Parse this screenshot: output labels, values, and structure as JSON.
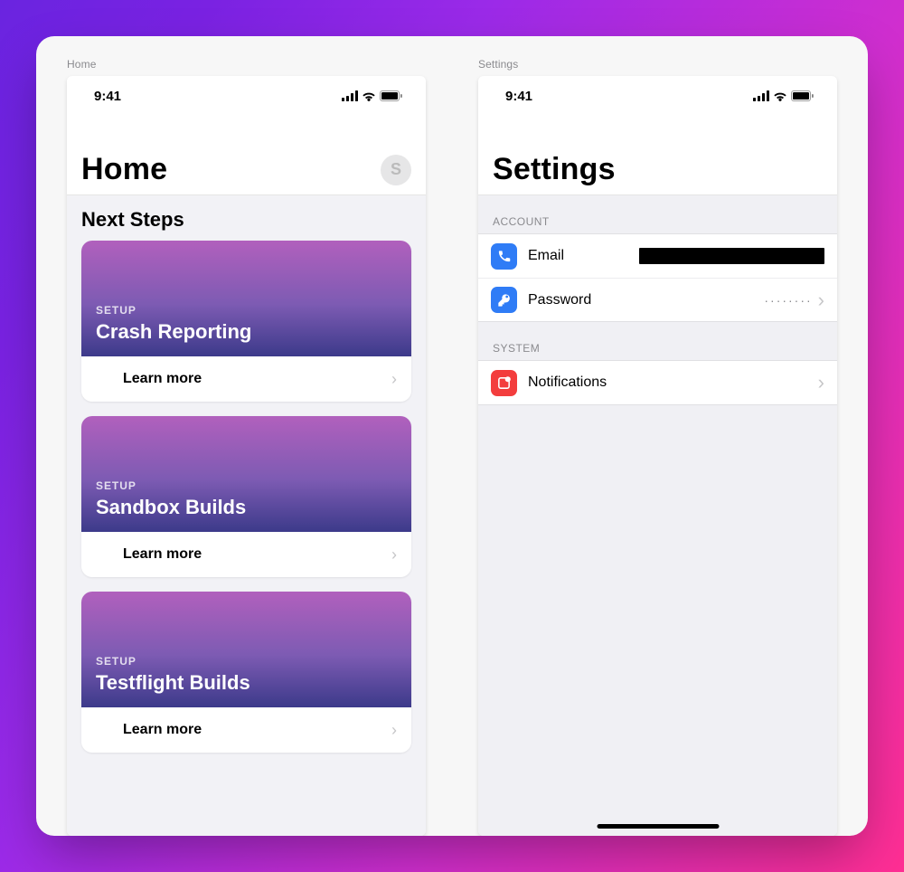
{
  "statusbar": {
    "time": "9:41"
  },
  "panels": {
    "home": {
      "label": "Home",
      "title": "Home",
      "avatar_initial": "S",
      "section_title": "Next Steps",
      "cards": [
        {
          "kicker": "SETUP",
          "title": "Crash Reporting",
          "cta": "Learn more"
        },
        {
          "kicker": "SETUP",
          "title": "Sandbox Builds",
          "cta": "Learn more"
        },
        {
          "kicker": "SETUP",
          "title": "Testflight Builds",
          "cta": "Learn more"
        }
      ]
    },
    "settings": {
      "label": "Settings",
      "title": "Settings",
      "sections": {
        "account": {
          "header": "ACCOUNT",
          "email_label": "Email",
          "password_label": "Password",
          "password_value": "········"
        },
        "system": {
          "header": "SYSTEM",
          "notifications_label": "Notifications"
        }
      }
    }
  }
}
